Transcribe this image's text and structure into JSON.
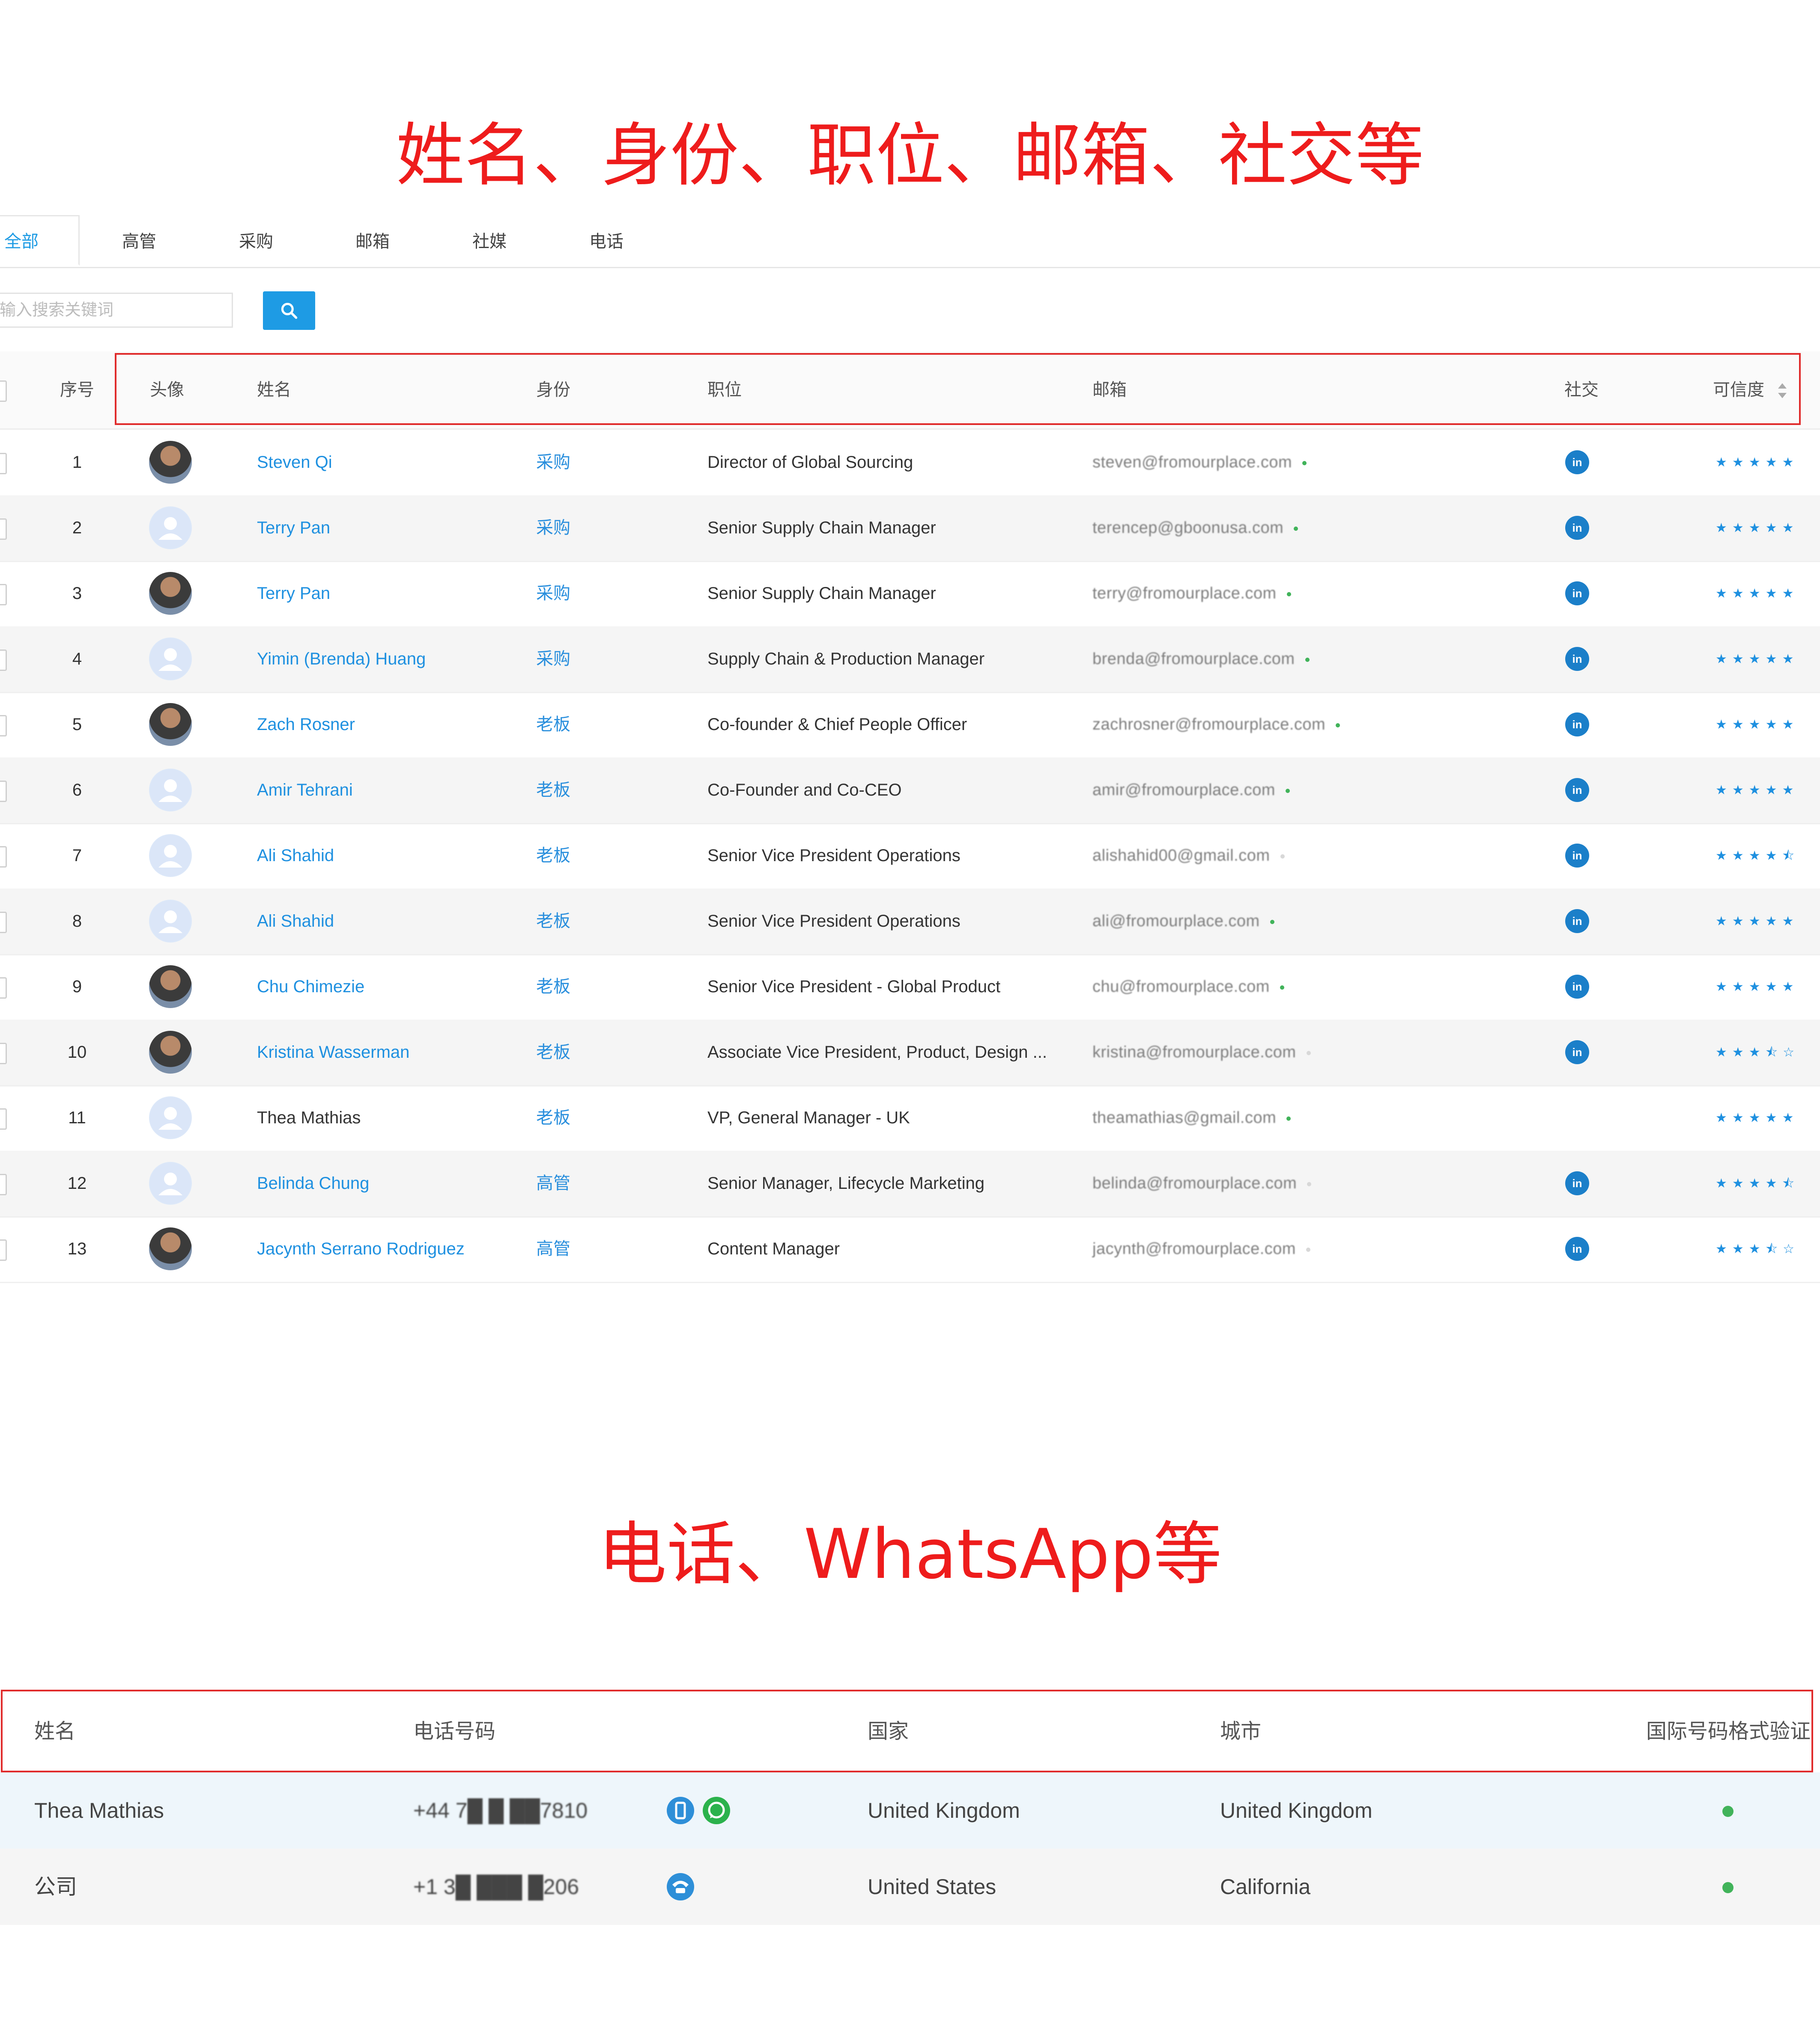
{
  "banners": {
    "top": "姓名、身份、职位、邮箱、社交等",
    "bottom": "电话、WhatsApp等"
  },
  "tabs": [
    "全部",
    "高管",
    "采购",
    "邮箱",
    "社媒",
    "电话"
  ],
  "active_tab": 0,
  "search": {
    "placeholder": "输入搜索关键词",
    "button_icon": "search-icon"
  },
  "contacts_table": {
    "headers": {
      "index": "序号",
      "avatar": "头像",
      "name": "姓名",
      "role": "身份",
      "title": "职位",
      "email": "邮箱",
      "social": "社交",
      "rating": "可信度"
    },
    "rows": [
      {
        "index": "1",
        "avatar": "photo",
        "name": "Steven Qi",
        "linked": true,
        "role": "采购",
        "title": "Director of Global Sourcing",
        "email": "steven@fromourplace.com",
        "email_status": "green",
        "social": "linkedin",
        "rating": "★★★★★"
      },
      {
        "index": "2",
        "avatar": "default",
        "name": "Terry Pan",
        "linked": true,
        "role": "采购",
        "title": "Senior Supply Chain Manager",
        "email": "terencep@gboonusa.com",
        "email_status": "green",
        "social": "linkedin",
        "rating": "★★★★★"
      },
      {
        "index": "3",
        "avatar": "photo",
        "name": "Terry Pan",
        "linked": true,
        "role": "采购",
        "title": "Senior Supply Chain Manager",
        "email": "terry@fromourplace.com",
        "email_status": "green",
        "social": "linkedin",
        "rating": "★★★★★"
      },
      {
        "index": "4",
        "avatar": "default",
        "name": "Yimin (Brenda) Huang",
        "linked": true,
        "role": "采购",
        "title": "Supply Chain & Production Manager",
        "email": "brenda@fromourplace.com",
        "email_status": "green",
        "social": "linkedin",
        "rating": "★★★★★"
      },
      {
        "index": "5",
        "avatar": "photo",
        "name": "Zach Rosner",
        "linked": true,
        "role": "老板",
        "title": "Co-founder & Chief People Officer",
        "email": "zachrosner@fromourplace.com",
        "email_status": "green",
        "social": "linkedin",
        "rating": "★★★★★"
      },
      {
        "index": "6",
        "avatar": "default",
        "name": "Amir Tehrani",
        "linked": true,
        "role": "老板",
        "title": "Co-Founder and Co-CEO",
        "email": "amir@fromourplace.com",
        "email_status": "green",
        "social": "linkedin",
        "rating": "★★★★★"
      },
      {
        "index": "7",
        "avatar": "default",
        "name": "Ali Shahid",
        "linked": true,
        "role": "老板",
        "title": "Senior Vice President Operations",
        "email": "alishahid00@gmail.com",
        "email_status": "grey",
        "social": "linkedin",
        "rating": "★★★★⯪"
      },
      {
        "index": "8",
        "avatar": "default",
        "name": "Ali Shahid",
        "linked": true,
        "role": "老板",
        "title": "Senior Vice President Operations",
        "email": "ali@fromourplace.com",
        "email_status": "green",
        "social": "linkedin",
        "rating": "★★★★★"
      },
      {
        "index": "9",
        "avatar": "photo",
        "name": "Chu Chimezie",
        "linked": true,
        "role": "老板",
        "title": "Senior Vice President - Global Product",
        "email": "chu@fromourplace.com",
        "email_status": "green",
        "social": "linkedin",
        "rating": "★★★★★"
      },
      {
        "index": "10",
        "avatar": "photo",
        "name": "Kristina Wasserman",
        "linked": true,
        "role": "老板",
        "title": "Associate Vice President, Product, Design ...",
        "email": "kristina@fromourplace.com",
        "email_status": "grey",
        "social": "linkedin",
        "rating": "★★★⯪☆"
      },
      {
        "index": "11",
        "avatar": "default",
        "name": "Thea Mathias",
        "linked": false,
        "role": "老板",
        "title": "VP, General Manager - UK",
        "email": "theamathias@gmail.com",
        "email_status": "green",
        "social": "",
        "rating": "★★★★★"
      },
      {
        "index": "12",
        "avatar": "default",
        "name": "Belinda Chung",
        "linked": true,
        "role": "高管",
        "title": "Senior Manager, Lifecycle Marketing",
        "email": "belinda@fromourplace.com",
        "email_status": "grey",
        "social": "linkedin",
        "rating": "★★★★⯪"
      },
      {
        "index": "13",
        "avatar": "photo",
        "name": "Jacynth Serrano Rodriguez",
        "linked": true,
        "role": "高管",
        "title": "Content Manager",
        "email": "jacynth@fromourplace.com",
        "email_status": "grey",
        "social": "linkedin",
        "rating": "★★★⯪☆"
      }
    ]
  },
  "phones_table": {
    "headers": {
      "name": "姓名",
      "phone": "电话号码",
      "country": "国家",
      "city": "城市",
      "validation": "国际号码格式验证"
    },
    "rows": [
      {
        "name": "Thea Mathias",
        "phone": "+44 7█ █ ██7810",
        "icons": [
          "mobile-icon",
          "whatsapp-icon"
        ],
        "country": "United Kingdom",
        "city": "United Kingdom",
        "valid": true
      },
      {
        "name": "公司",
        "phone": "+1 3█ ███ █206",
        "icons": [
          "landline-icon"
        ],
        "country": "United States",
        "city": "California",
        "valid": true
      }
    ]
  },
  "colors": {
    "accent": "#1e9be4",
    "banner_red": "#ee1c1c",
    "box_red": "#e02b2b",
    "status_green": "#41b35a",
    "status_grey": "#d8d8d8",
    "linkedin": "#1b7fc9"
  }
}
